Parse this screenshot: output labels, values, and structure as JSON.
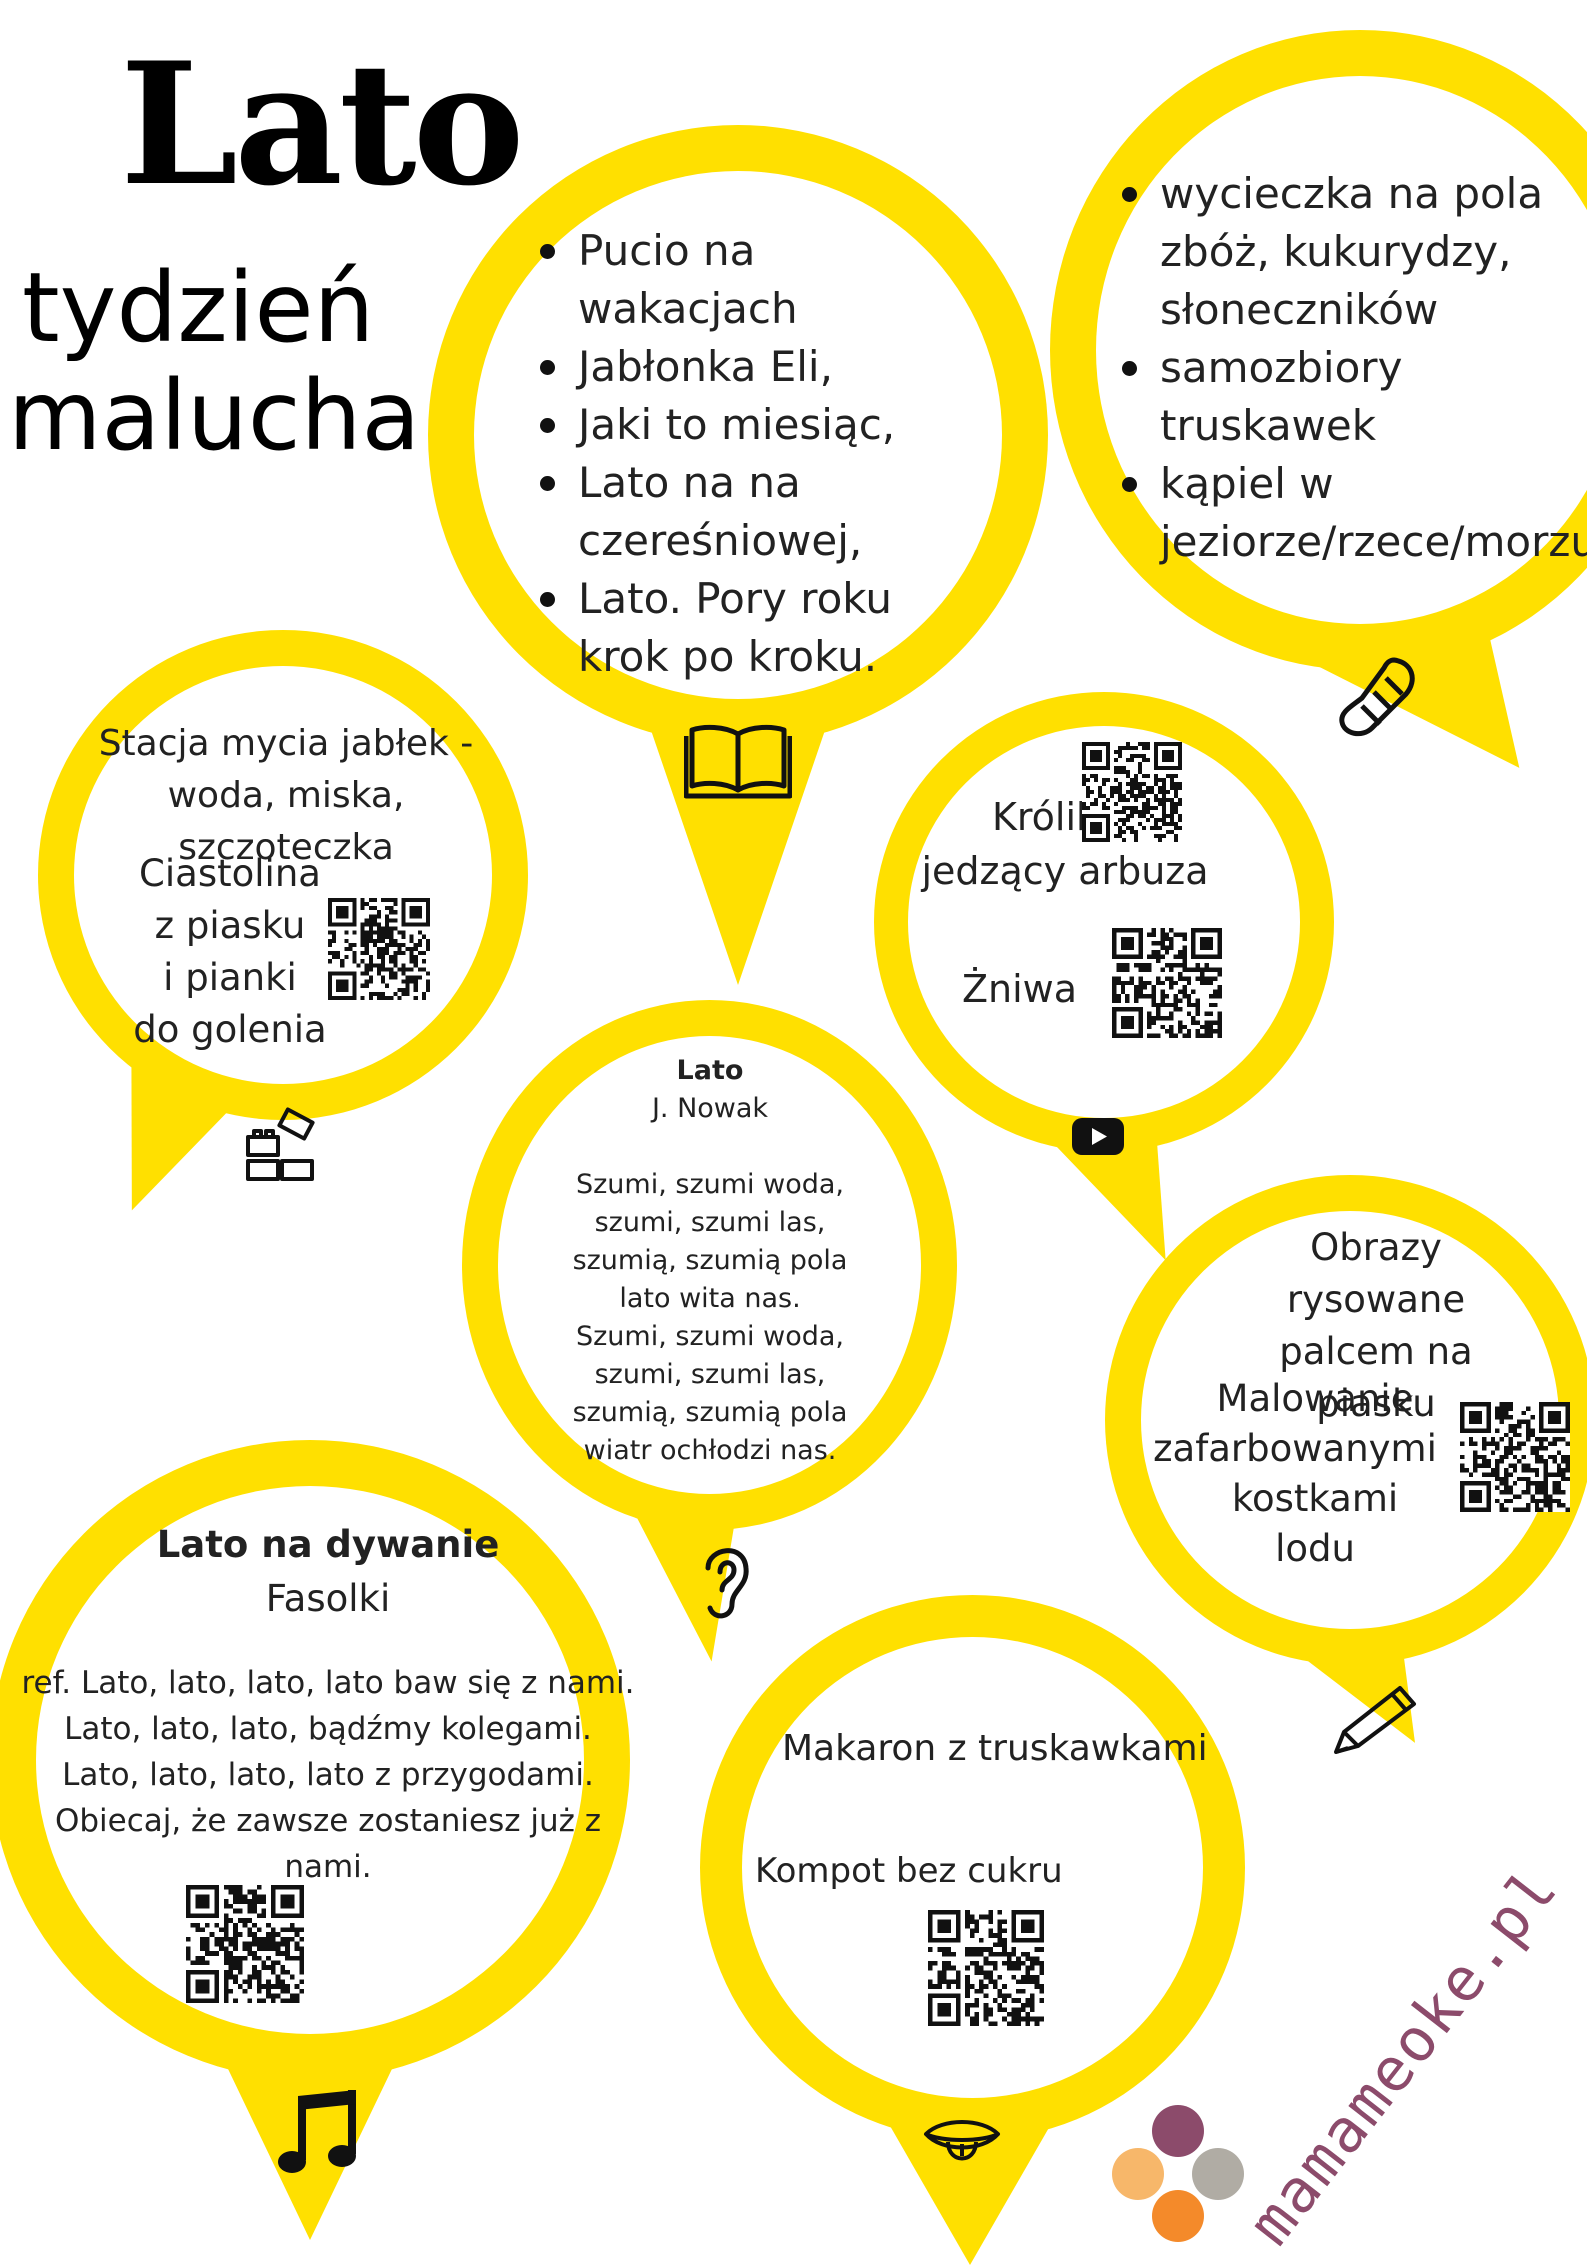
{
  "header": {
    "title": "Lato",
    "subtitle_line1": "tydzień",
    "subtitle_line2": "malucha"
  },
  "colors": {
    "accent": "#FFE000",
    "watermark": "#8c4b6b"
  },
  "books": {
    "items": [
      "Pucio na wakacjach",
      "Jabłonka Eli,",
      "Jaki to miesiąc,",
      "Lato na na czereśniowej,",
      "Lato. Pory roku krok po kroku."
    ],
    "icon": "open-book-icon"
  },
  "outings": {
    "items": [
      "wycieczka na pola zbóż, kukurydzy, słoneczników",
      "samozbiory truskawek",
      "kąpiel w jeziorze/rzece/morzu"
    ],
    "icon": "footprint-icon"
  },
  "sensory": {
    "line1": "Stacja mycia jabłek -",
    "line2": "woda, miska, szczoteczka",
    "dough": [
      "Ciastolina",
      "z piasku",
      "i pianki",
      "do golenia"
    ],
    "icon": "building-blocks-icon"
  },
  "videos": {
    "item1": [
      "Królik",
      "jedzący arbuza"
    ],
    "item2": "Żniwa",
    "icon": "youtube-play-icon"
  },
  "poem": {
    "title": "Lato",
    "author": "J. Nowak",
    "lines": [
      "Szumi, szumi woda,",
      "szumi, szumi las,",
      "szumią, szumią pola",
      "lato wita nas.",
      "Szumi, szumi woda,",
      "szumi, szumi las,",
      "szumią, szumią pola",
      "wiatr ochłodzi nas."
    ],
    "icon": "ear-icon"
  },
  "art": {
    "item1": [
      "Obrazy rysowane",
      "palcem na piasku"
    ],
    "item2": [
      "Malowanie",
      "zafarbowanymi",
      "kostkami lodu"
    ],
    "icon": "pencil-icon"
  },
  "song": {
    "title": "Lato na dywanie",
    "artist": "Fasolki",
    "lines": [
      "ref. Lato, lato, lato, lato baw się z nami.",
      "Lato, lato, lato, bądźmy kolegami.",
      "Lato, lato, lato, lato z przygodami.",
      "Obiecaj, że zawsze zostaniesz już z nami."
    ],
    "icon": "music-note-icon"
  },
  "food": {
    "item1": "Makaron z truskawkami",
    "item2": "Kompot bez cukru",
    "icon": "tongue-mouth-icon"
  },
  "brand": {
    "watermark": "mamameoke.pl",
    "dot_colors": [
      "#8c4b6b",
      "#f7b76a",
      "#b0aca4",
      "#f48a2a"
    ]
  }
}
